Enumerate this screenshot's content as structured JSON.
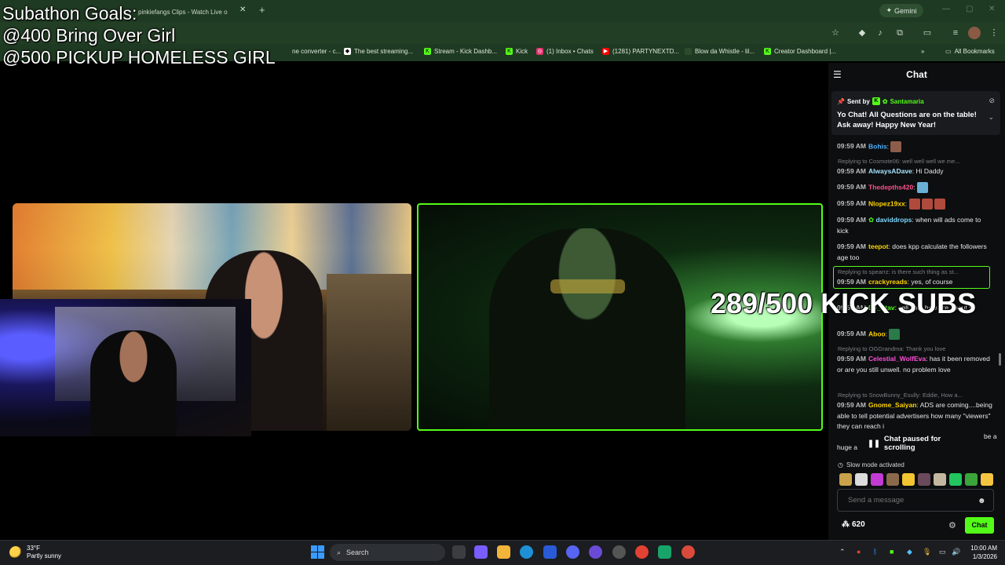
{
  "browser": {
    "active_tab_title": "pinkiefangs Clips - Watch Live o",
    "new_tab": "+",
    "close": "✕",
    "gemini_label": "Gemini",
    "bookmarks": [
      {
        "label": "ne converter - c...",
        "icon_color": "#1f3a22"
      },
      {
        "label": "The best streaming...",
        "icon_color": "#ffffff"
      },
      {
        "label": "Stream - Kick Dashb...",
        "icon_color": "#53fc18"
      },
      {
        "label": "Kick",
        "icon_color": "#53fc18"
      },
      {
        "label": "(1) Inbox • Chats",
        "icon_color": "#e1306c"
      },
      {
        "label": "(1281) PARTYNEXTD...",
        "icon_color": "#ff0000"
      },
      {
        "label": "Blow da Whistle - lil...",
        "icon_color": "#1f3a22"
      },
      {
        "label": "Creator Dashboard |...",
        "icon_color": "#53fc18"
      }
    ],
    "more_chevron": "»",
    "all_bookmarks": "All Bookmarks"
  },
  "overlay": {
    "goals": [
      "Subathon Goals:",
      "@400 Bring Over Girl",
      "@500 PICKUP HOMELESS GIRL"
    ],
    "subs_counter": "289/500 KICK SUBS"
  },
  "chat": {
    "title": "Chat",
    "pinned": {
      "sent_by_label": "Sent by",
      "sender": "Santamaria",
      "message": "Yo Chat! All Questions are on the table! Ask away! Happy New Year!"
    },
    "messages": [
      {
        "time": "09:59 AM",
        "user": "Bohis",
        "color": "#4fb0ff",
        "text": ""
      },
      {
        "reply": "Replying to Cosmote06: well well well we me..."
      },
      {
        "time": "09:59 AM",
        "user": "AlwaysADave",
        "color": "#a6e3ff",
        "text": "Hi Daddy"
      },
      {
        "time": "09:59 AM",
        "user": "Thedepths420",
        "color": "#ff4f8b",
        "text": ""
      },
      {
        "time": "09:59 AM",
        "user": "Nlopez19xx",
        "color": "#ffd400",
        "text": ""
      },
      {
        "time": "09:59 AM",
        "user": "daviddrops",
        "color": "#7fd7ff",
        "text": "when will ads come to kick"
      },
      {
        "time": "09:59 AM",
        "user": "teepot",
        "color": "#ffd400",
        "text": "does kpp calculate the followers age too"
      },
      {
        "reply": "Replying to spearrz: is there such thing as st..."
      },
      {
        "time": "09:59 AM",
        "user": "crackyreads",
        "color": "#ffd400",
        "text": "yes, of course"
      },
      {
        "time": "09:59 AM",
        "user": "DJ_Stav",
        "color": "#53fc18",
        "text": "call you, how are about it"
      },
      {
        "time": "09:59 AM",
        "user": "Aboo",
        "color": "#ffd400",
        "text": ""
      },
      {
        "reply": "Replying to OGGrandma: Thank you love"
      },
      {
        "time": "09:59 AM",
        "user": "Celestial_WolfEva",
        "color": "#ff4fd8",
        "text": "has it been removed or are you still unwell. no problem love"
      },
      {
        "reply": "Replying to SnowBunny_Esully: Eddie, How a..."
      },
      {
        "time": "09:59 AM",
        "user": "Gnome_Saiyan",
        "color": "#ffd400",
        "text": "ADS are coming....being able to tell potential advertisers how many \"viewers\" they can reach i"
      },
      {
        "tail": "huge a",
        "tail2": "be a"
      }
    ],
    "paused_label": "Chat paused for scrolling",
    "slow_mode": "Slow mode activated",
    "input_placeholder": "Send a message",
    "points": "620",
    "chat_button": "Chat"
  },
  "taskbar": {
    "weather_temp": "33°F",
    "weather_desc": "Partly sunny",
    "search_label": "Search",
    "time": "10:00 AM",
    "date": "1/3/2026"
  }
}
